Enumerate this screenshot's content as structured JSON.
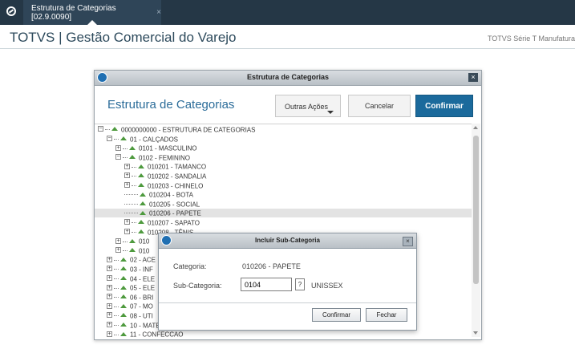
{
  "tab": {
    "title": "Estrutura de Categorias [02.9.0090]",
    "close": "×"
  },
  "app": {
    "title": "TOTVS | Gestão Comercial do Varejo",
    "right_text": "TOTVS Série T Manufatura"
  },
  "dialog": {
    "window_title": "Estrutura de Categorias",
    "close": "×",
    "heading": "Estrutura de Categorias",
    "buttons": {
      "outras": "Outras Ações",
      "cancelar": "Cancelar",
      "confirmar": "Confirmar"
    }
  },
  "tree": {
    "selected_index": 12,
    "items": [
      {
        "label": "0000000000 - ESTRUTURA DE CATEGORIAS",
        "expander": "−"
      },
      {
        "label": "01 - CALÇADOS",
        "expander": "−"
      },
      {
        "label": "0101 - MASCULINO",
        "expander": "+"
      },
      {
        "label": "0102 - FEMININO",
        "expander": "−"
      },
      {
        "label": "010201 - TAMANCO",
        "expander": "+"
      },
      {
        "label": "010202 - SANDALIA",
        "expander": "+"
      },
      {
        "label": "010203 - CHINELO",
        "expander": "+"
      },
      {
        "label": "010204 - BOTA",
        "expander": ""
      },
      {
        "label": "010205 - SOCIAL",
        "expander": ""
      },
      {
        "label": "010206 - PAPETE",
        "expander": ""
      },
      {
        "label": "010207 - SAPATO",
        "expander": "+"
      },
      {
        "label": "010208 - TÊNIS",
        "expander": "+"
      },
      {
        "label": "010",
        "expander": "+"
      },
      {
        "label": "010",
        "expander": "+"
      },
      {
        "label": "02 - ACE",
        "expander": "+"
      },
      {
        "label": "03 - INF",
        "expander": "+"
      },
      {
        "label": "04 - ELE",
        "expander": "+"
      },
      {
        "label": "05 - ELE",
        "expander": "+"
      },
      {
        "label": "06 - BRI",
        "expander": "+"
      },
      {
        "label": "07 - MO",
        "expander": "+"
      },
      {
        "label": "08 - UTI",
        "expander": "+"
      },
      {
        "label": "10 - MATERIAL DE CONSTRUCAO",
        "expander": "+"
      },
      {
        "label": "11 - CONFECCAO",
        "expander": "+"
      }
    ]
  },
  "subdialog": {
    "title": "Incluir Sub-Categoria",
    "close": "×",
    "categoria_label": "Categoria:",
    "categoria_value": "010206 - PAPETE",
    "subcat_label": "Sub-Categoria:",
    "subcat_input": "0104",
    "help": "?",
    "subcat_desc": "UNISSEX",
    "confirmar": "Confirmar",
    "fechar": "Fechar"
  }
}
